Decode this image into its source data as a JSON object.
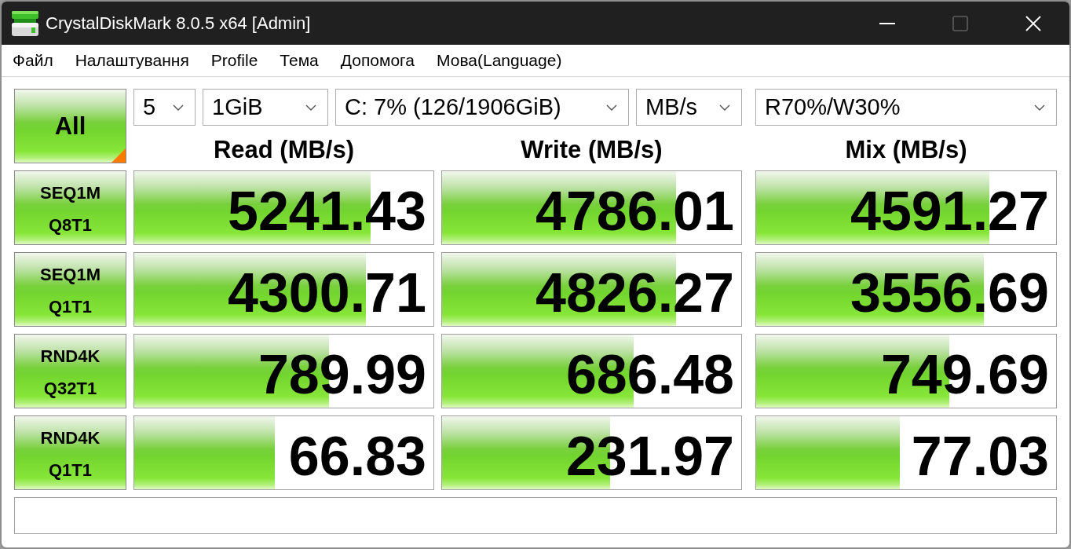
{
  "window": {
    "title": "CrystalDiskMark 8.0.5 x64 [Admin]",
    "maximize_button": {
      "disabled": true
    }
  },
  "menu": [
    {
      "label": "Файл"
    },
    {
      "label": "Налаштування"
    },
    {
      "label": "Profile"
    },
    {
      "label": "Тема"
    },
    {
      "label": "Допомога"
    },
    {
      "label": "Мова(Language)"
    }
  ],
  "all_button": {
    "label": "All"
  },
  "settings": [
    {
      "value": "5"
    },
    {
      "value": "1GiB"
    },
    {
      "value": "C: 7% (126/1906GiB)"
    },
    {
      "value": "MB/s"
    }
  ],
  "mix_setting": {
    "value": "R70%/W30%"
  },
  "columns": [
    "Read (MB/s)",
    "Write (MB/s)",
    "Mix (MB/s)"
  ],
  "rows": [
    {
      "test": "SEQ1M",
      "params": "Q8T1",
      "results": [
        {
          "value": "5241.43",
          "level": 0.79
        },
        {
          "value": "4786.01",
          "level": 0.782
        },
        {
          "value": "4591.27",
          "level": 0.777
        }
      ]
    },
    {
      "test": "SEQ1M",
      "params": "Q1T1",
      "results": [
        {
          "value": "4300.71",
          "level": 0.774
        },
        {
          "value": "4826.27",
          "level": 0.782
        },
        {
          "value": "3556.69",
          "level": 0.759
        }
      ]
    },
    {
      "test": "RND4K",
      "params": "Q32T1",
      "results": [
        {
          "value": "789.99",
          "level": 0.651
        },
        {
          "value": "686.48",
          "level": 0.64
        },
        {
          "value": "749.69",
          "level": 0.644
        }
      ]
    },
    {
      "test": "RND4K",
      "params": "Q1T1",
      "results": [
        {
          "value": "66.83",
          "level": 0.47
        },
        {
          "value": "231.97",
          "level": 0.562
        },
        {
          "value": "77.03",
          "level": 0.479
        }
      ]
    }
  ]
}
